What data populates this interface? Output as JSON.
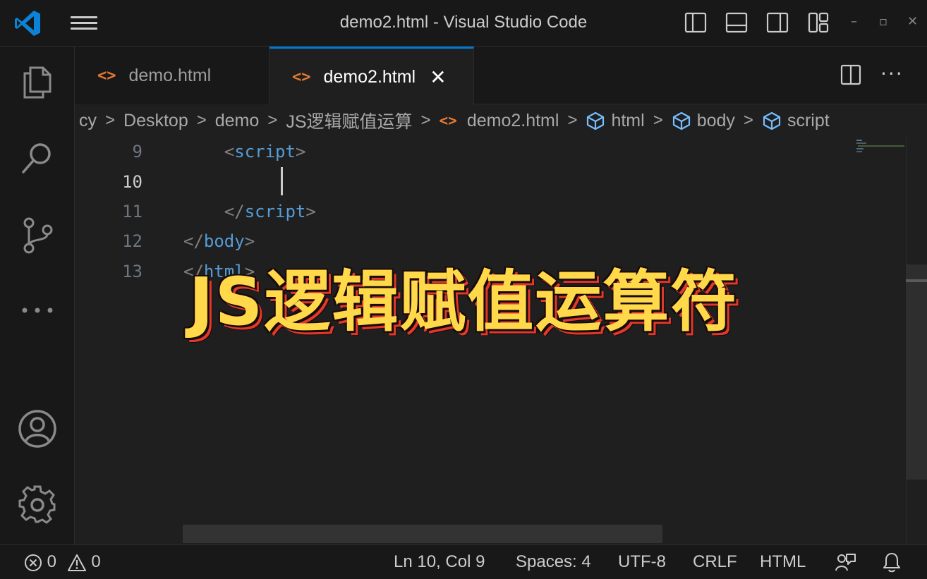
{
  "window": {
    "title": "demo2.html - Visual Studio Code"
  },
  "window_controls": {
    "minimize": "–",
    "restore": "▫",
    "close": "✕"
  },
  "tabs": [
    {
      "label": "demo.html",
      "icon": "html-tag-icon",
      "active": false
    },
    {
      "label": "demo2.html",
      "icon": "html-tag-icon",
      "active": true,
      "close": "✕"
    }
  ],
  "tab_icon_glyph": "<>",
  "tab_more": "···",
  "breadcrumb": {
    "items": [
      "cy",
      "Desktop",
      "demo",
      "JS逻辑赋值运算",
      "demo2.html",
      "html",
      "body",
      "script"
    ],
    "separator": ">"
  },
  "editor": {
    "lines": [
      {
        "number": "9",
        "indent": "    ",
        "open": "<",
        "tag": "script",
        "close": ">"
      },
      {
        "number": "10",
        "indent": "",
        "open": "",
        "tag": "",
        "close": ""
      },
      {
        "number": "11",
        "indent": "    ",
        "open": "</",
        "tag": "script",
        "close": ">"
      },
      {
        "number": "12",
        "indent": "",
        "open": "</",
        "tag": "body",
        "close": ">"
      },
      {
        "number": "13",
        "indent": "",
        "open": "</",
        "tag": "html",
        "close": ">"
      }
    ],
    "current_line": "10"
  },
  "caption": "JS逻辑赋值运算符",
  "statusbar": {
    "errors": "0",
    "warnings": "0",
    "position": "Ln 10, Col 9",
    "spaces": "Spaces: 4",
    "encoding": "UTF-8",
    "eol": "CRLF",
    "language": "HTML"
  },
  "colors": {
    "accent": "#0078d4",
    "html_icon": "#e37933",
    "tag": "#569cd6",
    "caption_fill": "#ffd94a",
    "caption_shadow": "#e0392b"
  }
}
